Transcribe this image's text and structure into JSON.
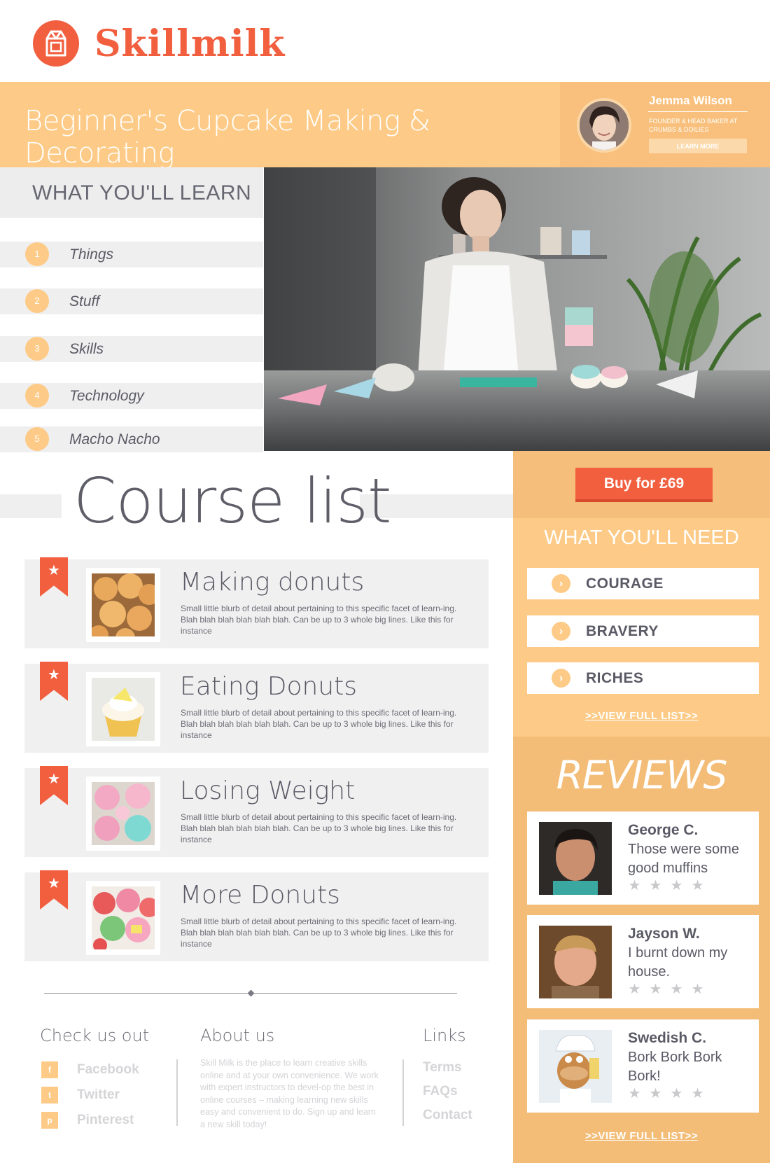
{
  "brand": {
    "name": "Skillmilk",
    "color": "#f15f3f",
    "icon": "milk-carton-icon"
  },
  "course": {
    "title": "Beginner's Cupcake Making & Decorating"
  },
  "instructor": {
    "name": "Jemma Wilson",
    "role": "FOUNDER & HEAD BAKER AT CRUMBS & DOILIES",
    "button": "LEARN MORE"
  },
  "learn": {
    "heading": "WHAT YOU'LL LEARN",
    "items": [
      {
        "num": "1",
        "label": "Things"
      },
      {
        "num": "2",
        "label": "Stuff"
      },
      {
        "num": "3",
        "label": "Skills"
      },
      {
        "num": "4",
        "label": "Technology"
      },
      {
        "num": "5",
        "label": "Macho Nacho"
      }
    ]
  },
  "course_list": {
    "heading": "Course list",
    "items": [
      {
        "title": "Making donuts",
        "desc": "Small little blurb of detail about pertaining to this specific facet of learn-ing. Blah blah blah blah blah blah. Can be up to 3 whole big lines. Like this for instance"
      },
      {
        "title": "Eating Donuts",
        "desc": "Small little blurb of detail about pertaining to this specific facet of learn-ing. Blah blah blah blah blah blah. Can be up to 3 whole big lines. Like this for instance"
      },
      {
        "title": "Losing Weight",
        "desc": "Small little blurb of detail about pertaining to this specific facet of learn-ing. Blah blah blah blah blah blah. Can be up to 3 whole big lines. Like this for instance"
      },
      {
        "title": "More Donuts",
        "desc": "Small little blurb of detail about pertaining to this specific facet of learn-ing. Blah blah blah blah blah blah. Can be up to 3 whole big lines. Like this for instance"
      }
    ]
  },
  "purchase": {
    "button": "Buy for £69"
  },
  "need": {
    "heading": "WHAT YOU'LL NEED",
    "items": [
      "COURAGE",
      "BRAVERY",
      "RICHES"
    ],
    "view_all": ">>VIEW FULL LIST>>"
  },
  "reviews": {
    "heading": "REVIEWS",
    "items": [
      {
        "name": "George C.",
        "text": "Those were some good muffins",
        "stars": 4
      },
      {
        "name": "Jayson W.",
        "text": "I burnt down my house.",
        "stars": 4
      },
      {
        "name": "Swedish C.",
        "text": "Bork Bork Bork Bork!",
        "stars": 4
      }
    ],
    "view_all": ">>VIEW FULL LIST>>"
  },
  "footer": {
    "social_heading": "Check us out",
    "social": [
      {
        "icon": "facebook-icon",
        "glyph": "f",
        "label": "Facebook"
      },
      {
        "icon": "twitter-icon",
        "glyph": "t",
        "label": "Twitter"
      },
      {
        "icon": "pinterest-icon",
        "glyph": "p",
        "label": "Pinterest"
      }
    ],
    "about_heading": "About us",
    "about_text": "Skill Milk is the place to learn creative skills online and at your own convenience. We work with expert instructors to devel-op the best in online courses – making learning new skills easy and convenient to do. Sign up and learn a new skill today!",
    "links_heading": "Links",
    "links": [
      "Terms",
      "FAQs",
      "Contact"
    ]
  },
  "colors": {
    "accent": "#f15f3f",
    "peach": "#fdcb87",
    "peach_dark": "#f3bd78",
    "grey": "#efefef"
  }
}
